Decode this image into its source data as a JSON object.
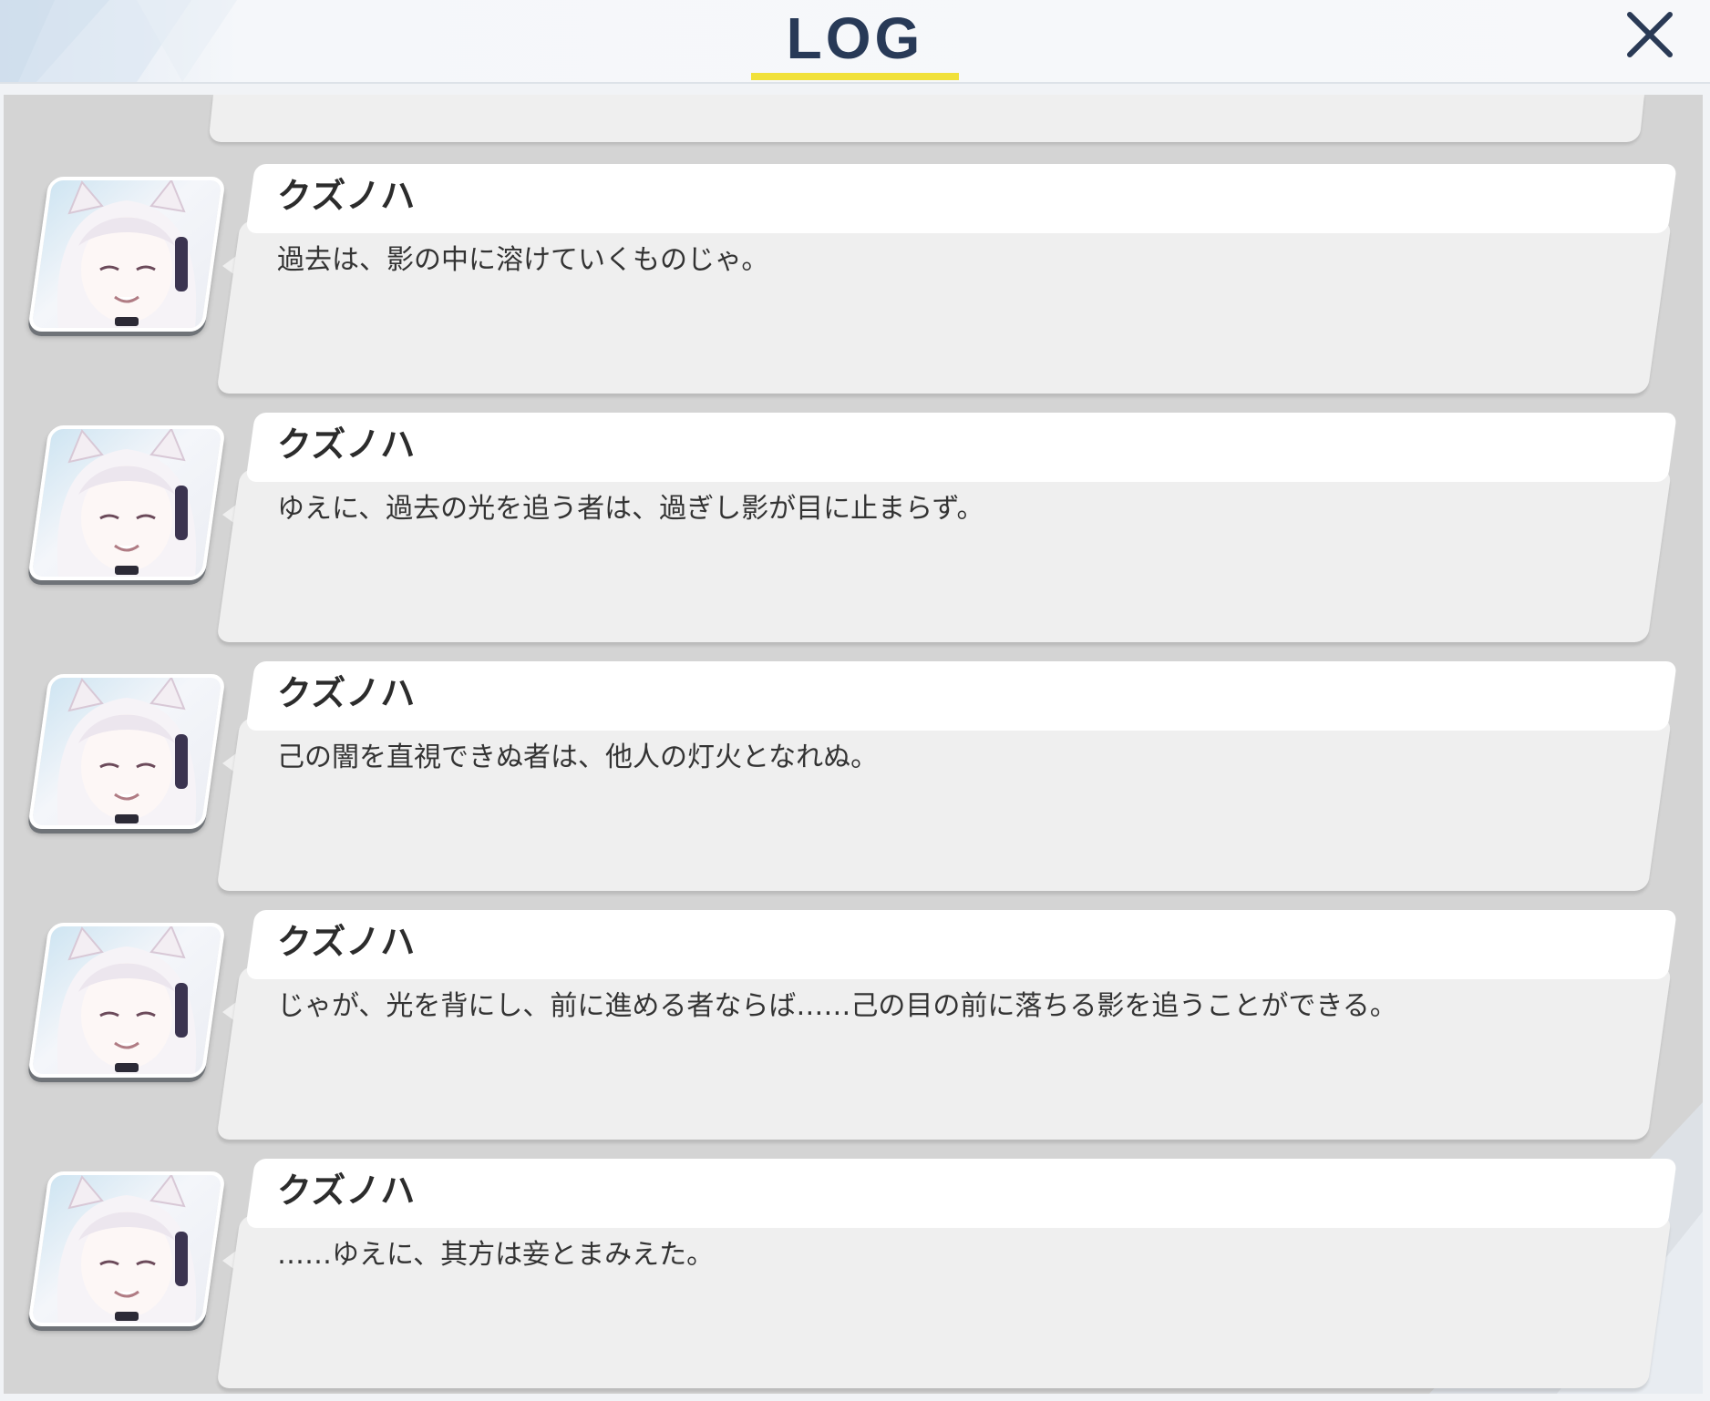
{
  "header": {
    "title": "LOG"
  },
  "colors": {
    "title": "#283a57",
    "underline": "#f1e13a",
    "panel": "#d4d4d4",
    "card": "#efefef",
    "name_tab": "#ffffff"
  },
  "log": [
    {
      "speaker": "クズノハ",
      "avatar": "kuzunoha-portrait",
      "text": "過去は、影の中に溶けていくものじゃ。"
    },
    {
      "speaker": "クズノハ",
      "avatar": "kuzunoha-portrait",
      "text": "ゆえに、過去の光を追う者は、過ぎし影が目に止まらず。"
    },
    {
      "speaker": "クズノハ",
      "avatar": "kuzunoha-portrait",
      "text": "己の闇を直視できぬ者は、他人の灯火となれぬ。"
    },
    {
      "speaker": "クズノハ",
      "avatar": "kuzunoha-portrait",
      "text": "じゃが、光を背にし、前に進める者ならば……己の目の前に落ちる影を追うことができる。"
    },
    {
      "speaker": "クズノハ",
      "avatar": "kuzunoha-portrait",
      "text": "……ゆえに、其方は妾とまみえた。"
    }
  ]
}
